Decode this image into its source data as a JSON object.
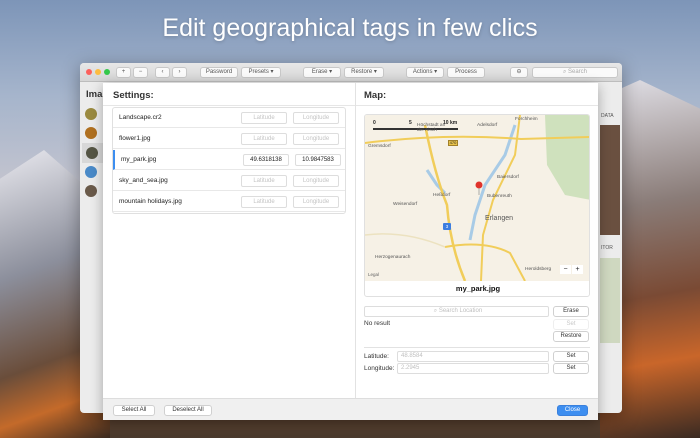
{
  "headline": "Edit geographical tags in few clics",
  "toolbar": {
    "password": "Password",
    "presets": "Presets",
    "erase": "Erase",
    "restore": "Restore",
    "actions": "Actions",
    "process": "Process",
    "search_placeholder": "Search"
  },
  "background_window": {
    "left_title": "Ima",
    "right_label_1": "DATA",
    "right_label_2": "ITOR"
  },
  "settings": {
    "title": "Settings:",
    "latitude_placeholder": "Latitude",
    "longitude_placeholder": "Longitude",
    "files": [
      {
        "name": "Landscape.cr2",
        "latitude": "",
        "longitude": "",
        "selected": false
      },
      {
        "name": "flower1.jpg",
        "latitude": "",
        "longitude": "",
        "selected": false
      },
      {
        "name": "my_park.jpg",
        "latitude": "49.6318138",
        "longitude": "10.9847583",
        "selected": true
      },
      {
        "name": "sky_and_sea.jpg",
        "latitude": "",
        "longitude": "",
        "selected": false
      },
      {
        "name": "mountain holidays.jpg",
        "latitude": "",
        "longitude": "",
        "selected": false
      }
    ],
    "select_all": "Select All",
    "deselect_all": "Deselect All"
  },
  "map": {
    "title": "Map:",
    "caption": "my_park.jpg",
    "scale": [
      "0",
      "5",
      "10 km"
    ],
    "places": [
      "Höchstadt an der Aisch",
      "Adelsdorf",
      "Forchheim",
      "Gremsdorf",
      "Heßdorf",
      "Baiersdorf",
      "Bubenreuth",
      "Weisendorf",
      "Erlangen",
      "Herzogenaurach",
      "Heroldsberg"
    ],
    "road_labels": [
      "470",
      "3"
    ],
    "legal": "Legal",
    "zoom_out": "−",
    "zoom_in": "+",
    "search_placeholder": "Search Location",
    "erase": "Erase",
    "set": "Set",
    "restore": "Restore",
    "status": "No result",
    "latitude_label": "Latitude:",
    "latitude_placeholder": "48.8584",
    "longitude_label": "Longitude:",
    "longitude_placeholder": "2.2945",
    "set_lat": "Set",
    "set_lon": "Set"
  },
  "close": "Close",
  "colors": {
    "accent": "#3d8ef0",
    "pin": "#e0332b",
    "map_bg": "#f6f1e6",
    "road": "#f1cd5a",
    "water": "#a8cbe6",
    "forest": "#cfe1bd"
  }
}
